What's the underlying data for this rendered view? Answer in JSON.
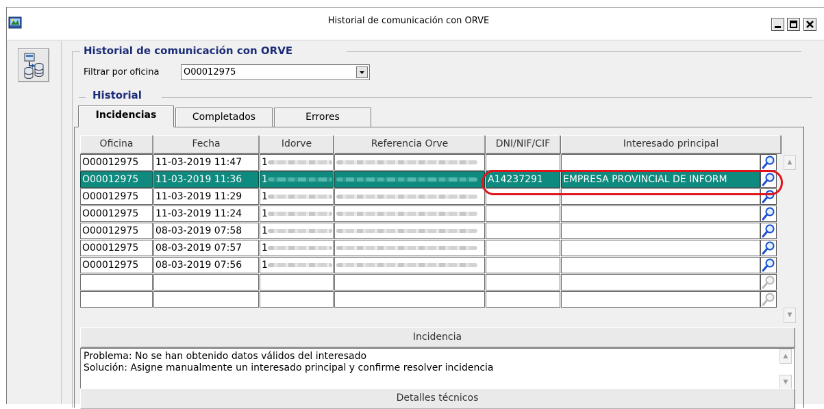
{
  "window": {
    "title": "Historial de comunicación con ORVE",
    "controls": [
      "minimize",
      "maximize",
      "close"
    ]
  },
  "group_header": "Historial de comunicación con ORVE",
  "filter": {
    "label": "Filtrar por oficina",
    "value": "O00012975"
  },
  "history_group": "Historial",
  "tabs": [
    {
      "label": "Incidencias",
      "active": true
    },
    {
      "label": "Completados",
      "active": false
    },
    {
      "label": "Errores",
      "active": false
    }
  ],
  "table": {
    "columns": [
      "Oficina",
      "Fecha",
      "Idorve",
      "Referencia Orve",
      "DNI/NIF/CIF",
      "Interesado principal"
    ],
    "rows": [
      {
        "oficina": "O00012975",
        "fecha": "11-03-2019 11:47",
        "idorve": "1",
        "referencia": "",
        "dni": "",
        "interesado": "",
        "selected": false
      },
      {
        "oficina": "O00012975",
        "fecha": "11-03-2019 11:36",
        "idorve": "1",
        "referencia": "",
        "dni": "A14237291",
        "interesado": "EMPRESA PROVINCIAL DE INFORM",
        "selected": true
      },
      {
        "oficina": "O00012975",
        "fecha": "11-03-2019 11:29",
        "idorve": "1",
        "referencia": "",
        "dni": "",
        "interesado": "",
        "selected": false
      },
      {
        "oficina": "O00012975",
        "fecha": "11-03-2019 11:24",
        "idorve": "1",
        "referencia": "",
        "dni": "",
        "interesado": "",
        "selected": false
      },
      {
        "oficina": "O00012975",
        "fecha": "08-03-2019 07:58",
        "idorve": "1",
        "referencia": "",
        "dni": "",
        "interesado": "",
        "selected": false
      },
      {
        "oficina": "O00012975",
        "fecha": "08-03-2019 07:57",
        "idorve": "1",
        "referencia": "",
        "dni": "",
        "interesado": "",
        "selected": false
      },
      {
        "oficina": "O00012975",
        "fecha": "08-03-2019 07:56",
        "idorve": "1",
        "referencia": "",
        "dni": "",
        "interesado": "",
        "selected": false
      },
      {
        "oficina": "",
        "fecha": "",
        "idorve": "",
        "referencia": "",
        "dni": "",
        "interesado": "",
        "selected": false
      },
      {
        "oficina": "",
        "fecha": "",
        "idorve": "",
        "referencia": "",
        "dni": "",
        "interesado": "",
        "selected": false
      }
    ]
  },
  "incidencia": {
    "header": "Incidencia",
    "problema": "Problema: No se han obtenido datos válidos del interesado",
    "solucion": "Solución: Asigne manualmente un interesado principal y confirme resolver incidencia"
  },
  "detalles": {
    "header": "Detalles técnicos"
  },
  "colors": {
    "selection": "#0f8a7e",
    "group_title": "#1c2d78",
    "highlight": "#e0141c"
  },
  "icons": [
    "app-icon",
    "database-transfer-icon",
    "magnifier-icon",
    "scroll-up-icon",
    "scroll-down-icon",
    "dropdown-arrow-icon"
  ]
}
